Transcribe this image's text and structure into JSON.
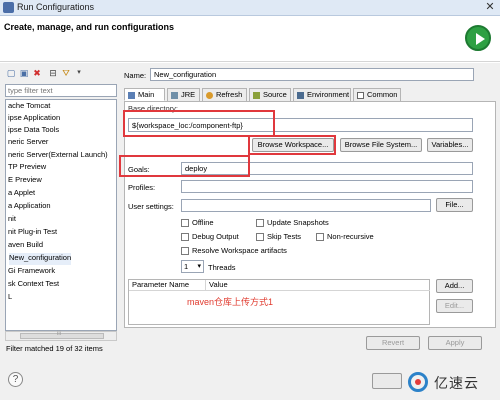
{
  "window": {
    "title": "Run Configurations"
  },
  "header": {
    "title": "Create, manage, and run configurations"
  },
  "left": {
    "filter_placeholder": "type filter text",
    "tree_items": [
      "ache Tomcat",
      "ipse Application",
      "ipse Data Tools",
      "neric Server",
      "neric Server(External Launch)",
      "TP Preview",
      "E Preview",
      "a Applet",
      "a Application",
      "nit",
      "nit Plug-in Test",
      "aven Build",
      "New_configuration",
      "Gi Framework",
      "sk Context Test",
      "L"
    ],
    "status": "Filter matched 19 of 32 items"
  },
  "main": {
    "name_label": "Name:",
    "name_value": "New_configuration",
    "tabs": [
      "Main",
      "JRE",
      "Refresh",
      "Source",
      "Environment",
      "Common"
    ],
    "base_dir_label": "Base directory:",
    "base_dir_value": "${workspace_loc:/component-ftp}",
    "btn_browse_workspace": "Browse Workspace...",
    "btn_browse_fs": "Browse File System...",
    "btn_variables": "Variables...",
    "goals_label": "Goals:",
    "goals_value": "deploy",
    "profiles_label": "Profiles:",
    "user_settings_label": "User settings:",
    "btn_file": "File...",
    "opt_offline": "Offline",
    "opt_update_snapshots": "Update Snapshots",
    "opt_debug_output": "Debug Output",
    "opt_skip_tests": "Skip Tests",
    "opt_non_recursive": "Non-recursive",
    "opt_resolve_workspace": "Resolve Workspace artifacts",
    "threads_value": "1",
    "threads_label": "Threads",
    "table_col_param": "Parameter Name",
    "table_col_value": "Value",
    "btn_add": "Add...",
    "btn_edit": "Edit...",
    "annotation": "maven仓库上传方式1",
    "btn_revert": "Revert",
    "btn_apply": "Apply"
  },
  "footer": {
    "help": "?",
    "logo_text": "亿速云"
  },
  "colors": {
    "highlight": "#e0383d",
    "run_green": "#2ea043",
    "annotation": "#e03a2e"
  }
}
